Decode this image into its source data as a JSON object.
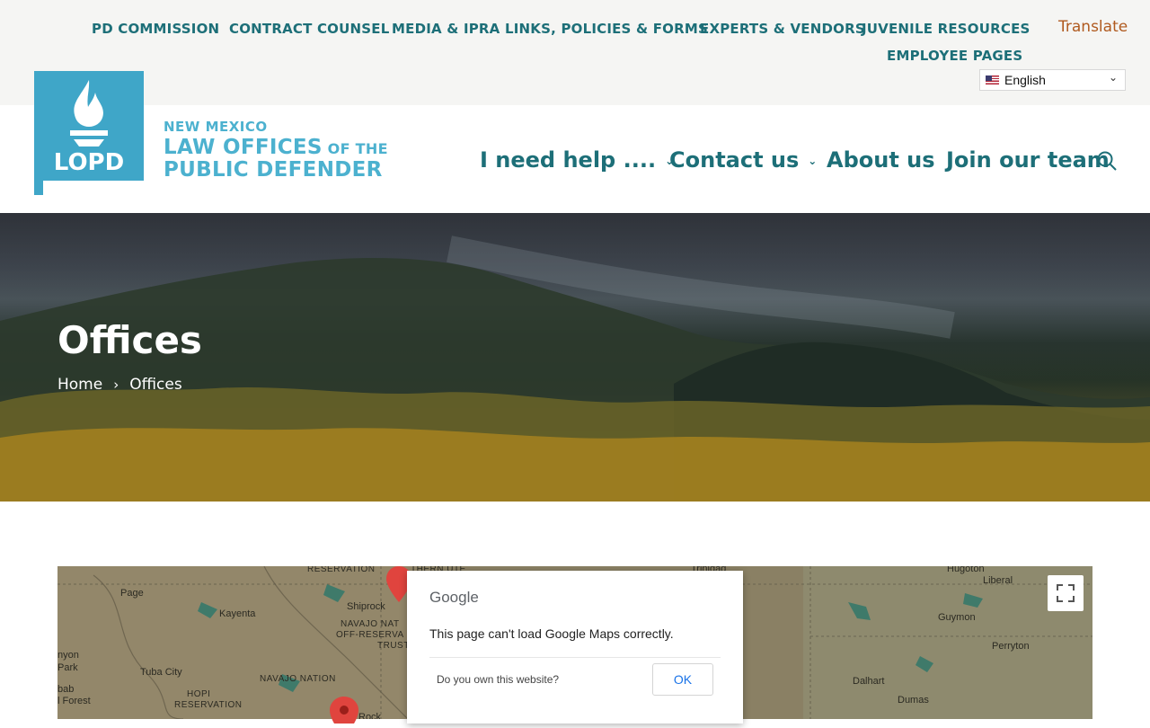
{
  "utility_nav": [
    {
      "label": "PD COMMISSION"
    },
    {
      "label": "CONTRACT COUNSEL"
    },
    {
      "label": "MEDIA & IPRA"
    },
    {
      "label": "LINKS, POLICIES & FORMS"
    },
    {
      "label": "EXPERTS & VENDORS"
    },
    {
      "label": "JUVENILE RESOURCES"
    },
    {
      "label": "EMPLOYEE PAGES"
    }
  ],
  "translate": {
    "label": "Translate",
    "selected_language": "English"
  },
  "logo": {
    "badge_text": "LOPD",
    "line1": "NEW MEXICO",
    "line2_main": "LAW OFFICES",
    "line2_small": " OF THE",
    "line3": "PUBLIC DEFENDER"
  },
  "main_nav": [
    {
      "label": "I need help ...."
    },
    {
      "label": "Contact us"
    },
    {
      "label": "About us"
    },
    {
      "label": "Join our team"
    }
  ],
  "hero": {
    "title": "Offices",
    "breadcrumb": [
      "Home",
      "Offices"
    ]
  },
  "map": {
    "labels": [
      "Page",
      "Kayenta",
      "nyon",
      "Park",
      "Tuba City",
      "bab",
      "l Forest",
      "HOPI",
      "RESERVATION",
      "NAVAJO NATION",
      "RESERVATION",
      "Shiprock",
      "NAVAJO NAT",
      "OFF-RESERVA",
      "TRUST LA",
      "THERN UTE",
      "Trinidad",
      "Hugoton",
      "Liberal",
      "Guymon",
      "Perryton",
      "Dalhart",
      "Dumas",
      "Rock"
    ],
    "dialog": {
      "brand": "Google",
      "message": "This page can't load Google Maps correctly.",
      "question": "Do you own this website?",
      "ok_label": "OK"
    }
  },
  "colors": {
    "brand_teal": "#1d6f78",
    "logo_blue": "#4cb1cf",
    "translate_orange": "#b05a1f"
  }
}
